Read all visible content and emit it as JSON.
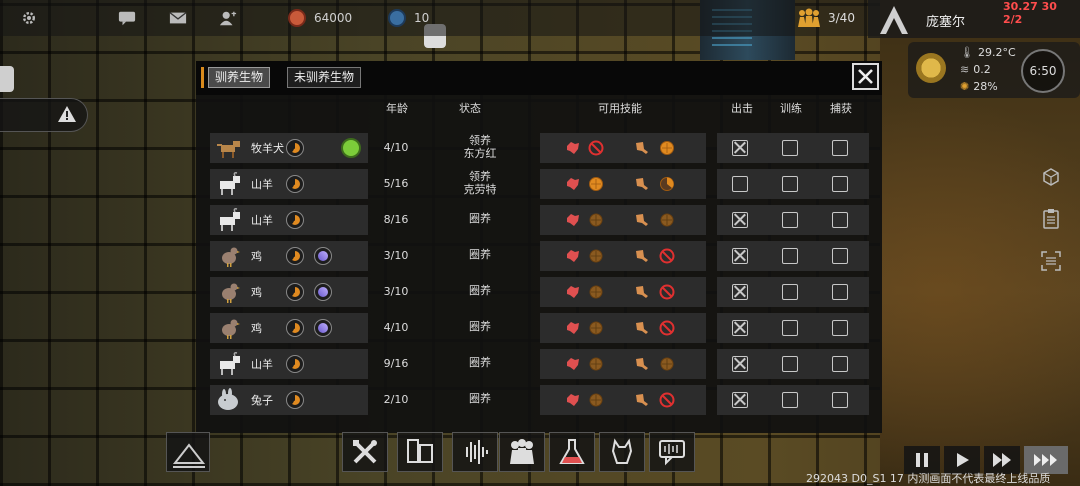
{
  "topbar": {
    "icons": [
      "gear-icon",
      "chat-icon",
      "mail-icon",
      "person-icon",
      "coin-icon",
      "shield-icon"
    ],
    "currency_value": "64000",
    "secondary_value": "10",
    "colony_count": "3/40",
    "colony_name": "庞塞尔",
    "clock_text": "30.27 30 2/2"
  },
  "weather": {
    "temperature": "29.2°C",
    "wind": "0.2",
    "humidity": "28%",
    "time": "6:50"
  },
  "dialog": {
    "tabs": [
      {
        "label": "驯养生物",
        "active": true
      },
      {
        "label": "未驯养生物",
        "active": false
      }
    ],
    "columns": {
      "age": "年龄",
      "status": "状态",
      "skills": "可用技能",
      "sortie": "出击",
      "train": "训练",
      "capture": "捕获"
    },
    "rows": [
      {
        "animal": "dog",
        "name": "牧羊犬",
        "traits": [
          "meat"
        ],
        "bulb": true,
        "age": "4/10",
        "status_line1": "领养",
        "status_line2": "东方红",
        "skills": [
          "heart-red",
          "ban",
          "tool",
          "orange-full"
        ],
        "sortie": true,
        "train": false,
        "capture": false
      },
      {
        "animal": "goat",
        "name": "山羊",
        "traits": [
          "meat"
        ],
        "bulb": false,
        "age": "5/16",
        "status_line1": "领养",
        "status_line2": "克劳特",
        "skills": [
          "heart-red",
          "orange-full",
          "tool",
          "orange-partial"
        ],
        "sortie": false,
        "train": false,
        "capture": false
      },
      {
        "animal": "goat",
        "name": "山羊",
        "traits": [
          "meat"
        ],
        "bulb": false,
        "age": "8/16",
        "status_line1": "圈养",
        "status_line2": "",
        "skills": [
          "heart-red",
          "orange-dim",
          "tool",
          "orange-dim"
        ],
        "sortie": true,
        "train": false,
        "capture": false
      },
      {
        "animal": "chicken",
        "name": "鸡",
        "traits": [
          "meat",
          "feather"
        ],
        "bulb": false,
        "age": "3/10",
        "status_line1": "圈养",
        "status_line2": "",
        "skills": [
          "heart-red",
          "orange-dim",
          "tool",
          "ban"
        ],
        "sortie": true,
        "train": false,
        "capture": false
      },
      {
        "animal": "chicken",
        "name": "鸡",
        "traits": [
          "meat",
          "feather"
        ],
        "bulb": false,
        "age": "3/10",
        "status_line1": "圈养",
        "status_line2": "",
        "skills": [
          "heart-red",
          "orange-dim",
          "tool",
          "ban"
        ],
        "sortie": true,
        "train": false,
        "capture": false
      },
      {
        "animal": "chicken",
        "name": "鸡",
        "traits": [
          "meat",
          "feather"
        ],
        "bulb": false,
        "age": "4/10",
        "status_line1": "圈养",
        "status_line2": "",
        "skills": [
          "heart-red",
          "orange-dim",
          "tool",
          "ban"
        ],
        "sortie": true,
        "train": false,
        "capture": false
      },
      {
        "animal": "goat",
        "name": "山羊",
        "traits": [
          "meat"
        ],
        "bulb": false,
        "age": "9/16",
        "status_line1": "圈养",
        "status_line2": "",
        "skills": [
          "heart-red",
          "orange-dim",
          "tool",
          "orange-dim"
        ],
        "sortie": true,
        "train": false,
        "capture": false
      },
      {
        "animal": "rabbit",
        "name": "兔子",
        "traits": [
          "meat"
        ],
        "bulb": false,
        "age": "2/10",
        "status_line1": "圈养",
        "status_line2": "",
        "skills": [
          "heart-red",
          "orange-dim",
          "tool",
          "ban"
        ],
        "sortie": true,
        "train": false,
        "capture": false
      }
    ]
  },
  "bottom_toolbar": {
    "buttons": [
      "build-tools-icon",
      "storage-icon",
      "sound-wave-icon",
      "people-icon",
      "flask-icon",
      "animal-icon",
      "chat-bubble-icon"
    ]
  },
  "speed_controls": [
    "pause-icon",
    "play-icon",
    "fast-forward-icon",
    "fastest-icon"
  ],
  "version_text": "292043 D0_S1 17  内测画面不代表最终上线品质",
  "colors": {
    "accent": "#d98a1c",
    "skill_red": "#e05050",
    "skill_orange": "#d98a1c",
    "bulb_green": "#7ccc3a",
    "clock_red": "#ff4d4d"
  }
}
